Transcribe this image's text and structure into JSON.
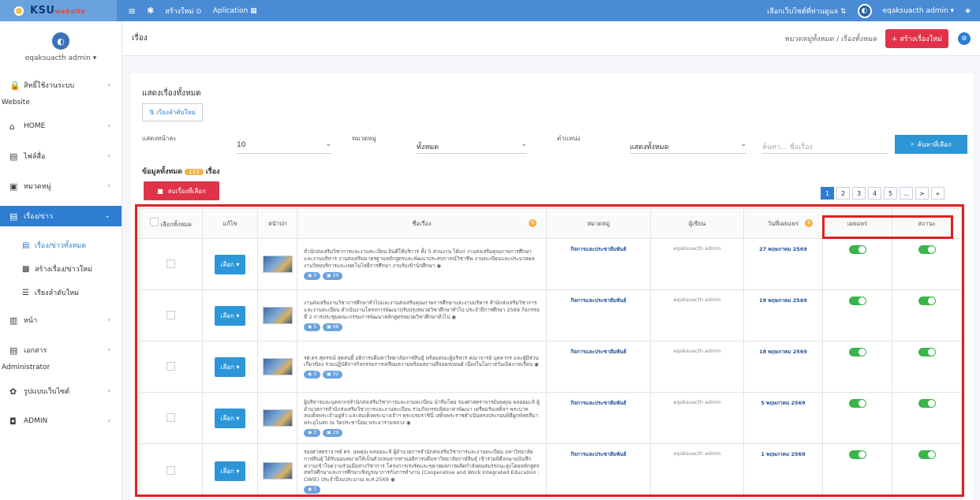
{
  "topbar": {
    "brand": "KSU",
    "brand_suffix": "website",
    "nav": [
      {
        "label": "≡"
      },
      {
        "label": "สร้างใหม่ ⊙"
      },
      {
        "label": "Aplication ▦"
      }
    ],
    "select_site": "เลือกเว็บไซต์ที่ท่านดูแล ⇅",
    "user": "eqaksuacth admin ▾"
  },
  "sidebar": {
    "user": "eqaksuacth admin ▾",
    "items": [
      {
        "label": "สิทธิ์ใช้งานระบบ",
        "icon": "🔒"
      },
      {
        "section": "Website"
      },
      {
        "label": "HOME",
        "icon": "⌂"
      },
      {
        "label": "ไฟล์สื่อ",
        "icon": "▤"
      },
      {
        "label": "หมวดหมู่",
        "icon": "▣"
      },
      {
        "label": "เรื่อง/ข่าว",
        "icon": "▤"
      },
      {
        "label": "หน้า",
        "icon": "▥"
      },
      {
        "label": "เอกสาร",
        "icon": "▤"
      },
      {
        "section": "Administrator"
      },
      {
        "label": "รูปแบบเว็บไซต์",
        "icon": "✿"
      },
      {
        "label": "ADMIN",
        "icon": "◘"
      }
    ],
    "subitems": [
      {
        "label": "เรื่อง/ข่าวทั้งหมด"
      },
      {
        "label": "สร้างเรื่อง/ข่าวใหม่"
      },
      {
        "label": "เรียงลำดับใหม่"
      }
    ]
  },
  "page": {
    "title": "เรื่อง",
    "breadcrumb": "หมวดหมู่ทั้งหมด / เรื่องทั้งหมด",
    "new_button": "+ สร้างเรื่องใหม่"
  },
  "card": {
    "title": "แสดงเรื่องทั้งหมด",
    "sort_button": "เรียงลำดับใหม่",
    "filters": {
      "per_page_label": "แสดงหน้าละ",
      "per_page_value": "10",
      "category_label": "หมวดหมู่",
      "category_value": "ทั้งหมด",
      "position_label": "ตำแหน่ง",
      "position_value": "แสดงทั้งหมด",
      "search_placeholder": "ค้นหา... ชื่อเรื่อง",
      "search_button": "ค้นหาที่เลือก"
    },
    "count_label": "ข้อมูลทั้งหมด",
    "count_value": "123",
    "count_suffix": "เรื่อง",
    "delete_button": "ลบเรื่องที่เลือก",
    "pages": [
      "1",
      "2",
      "3",
      "4",
      "5",
      "...",
      ">",
      "»"
    ]
  },
  "table": {
    "headers": [
      "เลือกทั้งหมด",
      "แก้ไข",
      "หน้าปก",
      "ชื่อเรื่อง",
      "หมวดหมู่",
      "ผู้เขียน",
      "วันที่เผยแพร่",
      "เผยแพร่",
      "สถานะ"
    ],
    "rows": [
      {
        "edit": "เลือก ▾",
        "title": "สำนักส่งเสริมวิชาการและงานทะเบียน ยินดีให้บริการ ทั้ง 5 ส่วนงาน ได้แก่ งานส่งเสริมคุณภาพการศึกษา และงานบริหาร งานส่งเสริมมาตรฐานหลักสูตรและพัฒนาประสบการณ์วิชาชีพ งานทะเบียนและประมวลผล งานวิทยบริการและเทคโนโลยีการศึกษา งานรับเข้านักศึกษา ◉",
        "tags": [
          "◉ 3",
          "▣ 24"
        ],
        "category": "กิจการและประชาสัมพันธ์",
        "author": "eqaksuacth admin",
        "date": "27 พฤษภาคม 2569"
      },
      {
        "edit": "เลือก ▾",
        "title": "งานส่งเสริมงานวิชาการศึกษาทั่วไปและงานส่งเสริมคุณภาพการศึกษาและงานบริหาร สำนักส่งเสริมวิชาการและงานทะเบียน ดำเนินงานโครงการพัฒนาปรับปรุงหมวดวิชาศึกษาทั่วไป ประจำปีการศึกษา 2569 กิจกรรมที่ 2 การประชุมคณะกรรมการพัฒนาหลักสูตรหมวดวิชาศึกษาทั่วไป ◉",
        "tags": [
          "◉ 5",
          "▣ 48"
        ],
        "category": "กิจการและประชาสัมพันธ์",
        "author": "eqaksuacth admin",
        "date": "19 พฤษภาคม 2569"
      },
      {
        "edit": "เลือก ▾",
        "title": "รศ.ดร.สุพรรณ์ สุดสนธิ์ อธิการบดีมหาวิทยาลัยกาฬสินธุ์ พร้อมคณะผู้บริหาร คณาจารย์ บุคลากร และผู้มีส่วนเกี่ยวข้อง ร่วมปฏิบัติการกิจกรรมการเตรียมความพร้อมสถานที่จอดรถยนต์ เนื่องในโอกาสวันเปิดภาคเรียน ◉",
        "tags": [
          "◉ 3",
          "▣ 32"
        ],
        "category": "กิจการและประชาสัมพันธ์",
        "author": "eqaksuacth admin",
        "date": "18 พฤษภาคม 2569"
      },
      {
        "edit": "เลือก ▾",
        "title": "ผู้บริหารและบุคลากรสำนักส่งเสริมวิชาการและงานทะเบียน นำทีมโดย รองศาสตราจารย์นพคุณ พลอยมะลิ ผู้อำนวยการสำนักส่งเสริมวิชาการและงานทะเบียน ร่วมกิจกรรมจิตอาสาพัฒนา เตรียมรับเสด็จฯ พระบาทสมเด็จพระเจ้าอยู่หัว และสมเด็จพระนางเจ้าฯ พระบรมราชินี เสด็จพระราชดำเนินทรงประกอบพิธีผูกพัทธสีมาพระอุโบสถ ณ วัดประชานิยม พระอารามหลวง ◉",
        "tags": [
          "◉ 3",
          "▣ 29"
        ],
        "category": "กิจการและประชาสัมพันธ์",
        "author": "eqaksuacth admin",
        "date": "5 พฤษภาคม 2569"
      },
      {
        "edit": "เลือก ▾",
        "title": "รองศาสตราจารย์ ดร. นพคุณ พลอยมะลิ ผู้อำนวยการสำนักส่งเสริมวิชาการและงานทะเบียน มหาวิทยาลัยกาฬสินธุ์ ได้รับมอบหมายให้เป็นตัวแทนจากท่านอธิการบดีมหาวิทยาลัยกาฬสินธุ์ เข้าร่วมพิธีลงนามบันทึกความเข้าใจความร่วมมือทางวิชาการ โครงการเร่งรัดและขยายผลการผลิตกำลังคนสมรรถนะสูงโดยหลักสูตรสหกิจศึกษาและการศึกษาเชิงบูรณาการกับการทำงาน (Cooperative and Work Integrated Education : CWIE) ประจำปีงบประมาณ พ.ศ.2569 ◉",
        "tags": [
          "◉ 3"
        ],
        "category": "กิจการและประชาสัมพันธ์",
        "author": "eqaksuacth admin",
        "date": "1 พฤษภาคม 2569"
      }
    ]
  }
}
